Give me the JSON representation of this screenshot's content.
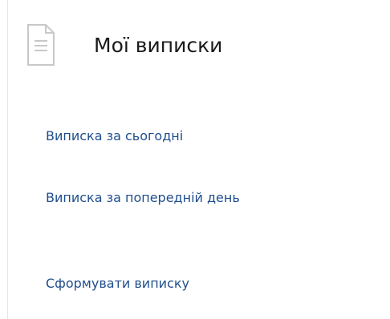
{
  "header": {
    "title": "Мої виписки",
    "icon": "document-icon"
  },
  "menu": {
    "items": [
      {
        "label": "Виписка за сьогодні"
      },
      {
        "label": "Виписка за попередній день"
      },
      {
        "label": "Сформувати виписку"
      }
    ]
  },
  "colors": {
    "link": "#1f4e8c",
    "title": "#1a1a1a",
    "icon_stroke": "#c8c8c8",
    "border": "#e6e6e6"
  }
}
